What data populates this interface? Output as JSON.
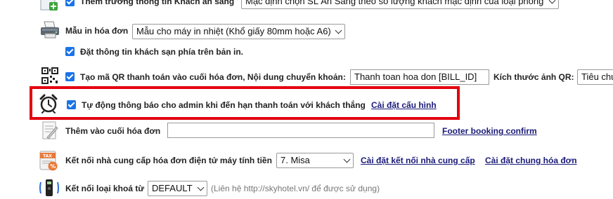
{
  "colors": {
    "accent": "#1a73e8",
    "highlight": "#e3000f",
    "link": "#1a1a7a"
  },
  "rows": {
    "row1": {
      "icon": "plus-document-icon",
      "checked": true,
      "label": "Thêm trường thông tin Khách ăn sáng",
      "select_value": "Mặc định chọn SL Ăn Sáng theo số lượng khách mặc định của loại phòng"
    },
    "row2": {
      "icon": "printer-icon",
      "label": "Mẫu in hóa đơn",
      "select_value": "Mẫu cho máy in nhiệt (Khổ giấy 80mm hoặc A6)"
    },
    "row3": {
      "checked": true,
      "label": "Đặt thông tin khách sạn phía trên bản in."
    },
    "row4": {
      "icon": "qr-code-icon",
      "checked": true,
      "label": "Tạo mã QR thanh toán vào cuối hóa đơn, Nội dung chuyển khoản:",
      "input_value": "Thanh toan hoa don [BILL_ID]",
      "size_label": "Kích thước ảnh QR:",
      "size_select_value": "Tiêu chu"
    },
    "row5": {
      "icon": "alarm-clock-icon",
      "checked": true,
      "label": "Tự động thông báo cho admin khi đến hạn thanh toán với khách thắng",
      "link": "Cài đặt cấu hình"
    },
    "row6": {
      "icon": "note-pen-icon",
      "label": "Thêm vào cuối hóa đơn",
      "input_value": "",
      "link": "Footer booking confirm"
    },
    "row7": {
      "icon": "tax-document-icon",
      "label": "Kết nối nhà cung cấp hóa đơn điện tử máy tính tiền",
      "select_value": "7. Misa",
      "link1": "Cài đặt kết nối nhà cung cấp",
      "link2": "Cài đặt chung hóa đơn"
    },
    "row8": {
      "icon": "door-lock-icon",
      "label": "Kết nối loại khoá từ",
      "select_value": "DEFAULT",
      "hint": "(Liên hệ http://skyhotel.vn/ để được sử dụng)"
    }
  }
}
